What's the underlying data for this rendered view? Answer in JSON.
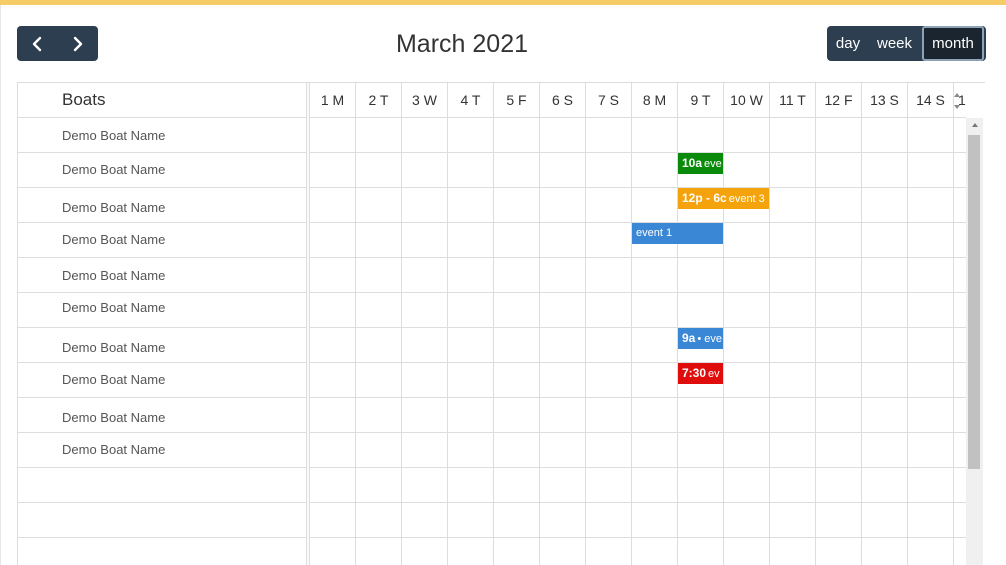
{
  "toolbar": {
    "title": "March 2021",
    "prev_icon": "chevron-left-icon",
    "next_icon": "chevron-right-icon",
    "views": {
      "day": "day",
      "week": "week",
      "month": "month"
    },
    "active_view": "month"
  },
  "colors": {
    "toolbar_bg": "#2c3e50",
    "accent_bar": "#f6cc66",
    "event_green": "#0a8a0a",
    "event_orange": "#f4a30d",
    "event_blue": "#3a87d6",
    "event_red": "#e00d0d"
  },
  "resources": {
    "header": "Boats",
    "items": [
      "Demo Boat Name",
      "Demo Boat Name",
      "Demo Boat Name",
      "Demo Boat Name",
      "Demo Boat Name",
      "Demo Boat Name",
      "Demo Boat Name",
      "Demo Boat Name",
      "Demo Boat Name",
      "Demo Boat Name"
    ]
  },
  "days": [
    "1 M",
    "2 T",
    "3 W",
    "4 T",
    "5 F",
    "6 S",
    "7 S",
    "8 M",
    "9 T",
    "10 W",
    "11 T",
    "12 F",
    "13 S",
    "14 S",
    "1"
  ],
  "events": [
    {
      "time": "10a",
      "title": "eve",
      "color": "#0a8a0a"
    },
    {
      "time": "12p - 6c",
      "title": "event 3",
      "color": "#f4a30d"
    },
    {
      "time": "",
      "title": "event 1",
      "color": "#3a87d6"
    },
    {
      "time": "9a",
      "title": "• eve",
      "color": "#3a87d6"
    },
    {
      "time": "7:30",
      "title": "ev",
      "color": "#e00d0d"
    }
  ]
}
